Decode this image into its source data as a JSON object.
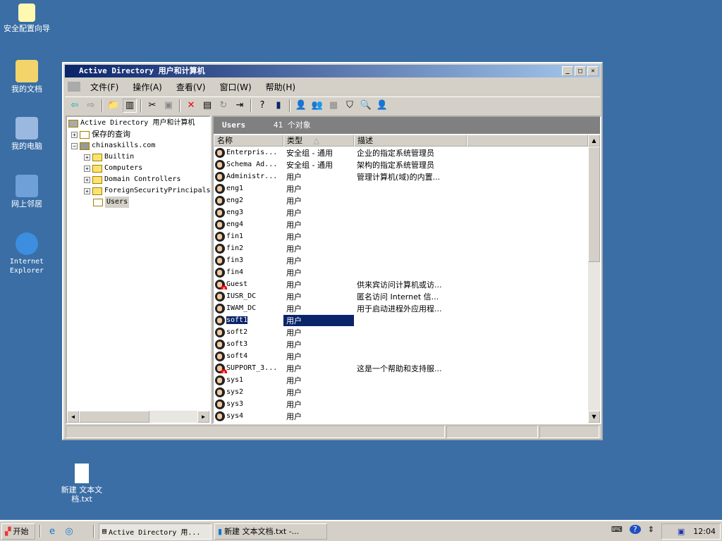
{
  "desktop": {
    "icons": [
      {
        "label": "安全配置向导"
      },
      {
        "label": "我的文档"
      },
      {
        "label": "我的电脑"
      },
      {
        "label": "网上邻居"
      },
      {
        "label": "Internet Explorer"
      },
      {
        "label": "新建 文本文档.txt"
      }
    ]
  },
  "window": {
    "title": "Active Directory 用户和计算机",
    "menu": [
      "文件(F)",
      "操作(A)",
      "查看(V)",
      "窗口(W)",
      "帮助(H)"
    ],
    "tree": {
      "root": "Active Directory 用户和计算机",
      "saved": "保存的查询",
      "domain": "chinaskills.com",
      "children": [
        "Builtin",
        "Computers",
        "Domain Controllers",
        "ForeignSecurityPrincipals",
        "Users"
      ]
    },
    "pane": {
      "title": "Users",
      "count": "41 个对象",
      "columns": [
        "名称",
        "类型",
        "描述"
      ],
      "rows": [
        {
          "name": "Enterpris...",
          "type": "安全组 - 通用",
          "desc": "企业的指定系统管理员",
          "icon": "group"
        },
        {
          "name": "Schema Ad...",
          "type": "安全组 - 通用",
          "desc": "架构的指定系统管理员",
          "icon": "group"
        },
        {
          "name": "Administr...",
          "type": "用户",
          "desc": "管理计算机(域)的内置...",
          "icon": "user"
        },
        {
          "name": "eng1",
          "type": "用户",
          "desc": "",
          "icon": "user"
        },
        {
          "name": "eng2",
          "type": "用户",
          "desc": "",
          "icon": "user"
        },
        {
          "name": "eng3",
          "type": "用户",
          "desc": "",
          "icon": "user"
        },
        {
          "name": "eng4",
          "type": "用户",
          "desc": "",
          "icon": "user"
        },
        {
          "name": "fin1",
          "type": "用户",
          "desc": "",
          "icon": "user"
        },
        {
          "name": "fin2",
          "type": "用户",
          "desc": "",
          "icon": "user"
        },
        {
          "name": "fin3",
          "type": "用户",
          "desc": "",
          "icon": "user"
        },
        {
          "name": "fin4",
          "type": "用户",
          "desc": "",
          "icon": "user"
        },
        {
          "name": "Guest",
          "type": "用户",
          "desc": "供来宾访问计算机或访...",
          "icon": "user-disabled"
        },
        {
          "name": "IUSR_DC",
          "type": "用户",
          "desc": "匿名访问 Internet 信...",
          "icon": "user"
        },
        {
          "name": "IWAM_DC",
          "type": "用户",
          "desc": "用于启动进程外应用程...",
          "icon": "user"
        },
        {
          "name": "soft1",
          "type": "用户",
          "desc": "",
          "icon": "user",
          "selected": true
        },
        {
          "name": "soft2",
          "type": "用户",
          "desc": "",
          "icon": "user"
        },
        {
          "name": "soft3",
          "type": "用户",
          "desc": "",
          "icon": "user"
        },
        {
          "name": "soft4",
          "type": "用户",
          "desc": "",
          "icon": "user"
        },
        {
          "name": "SUPPORT_3...",
          "type": "用户",
          "desc": "这是一个帮助和支持服...",
          "icon": "user-disabled"
        },
        {
          "name": "sys1",
          "type": "用户",
          "desc": "",
          "icon": "user"
        },
        {
          "name": "sys2",
          "type": "用户",
          "desc": "",
          "icon": "user"
        },
        {
          "name": "sys3",
          "type": "用户",
          "desc": "",
          "icon": "user"
        },
        {
          "name": "sys4",
          "type": "用户",
          "desc": "",
          "icon": "user"
        }
      ]
    }
  },
  "taskbar": {
    "start": "开始",
    "tasks": [
      "Active Directory 用...",
      "新建 文本文档.txt -..."
    ],
    "clock": "12:04"
  }
}
